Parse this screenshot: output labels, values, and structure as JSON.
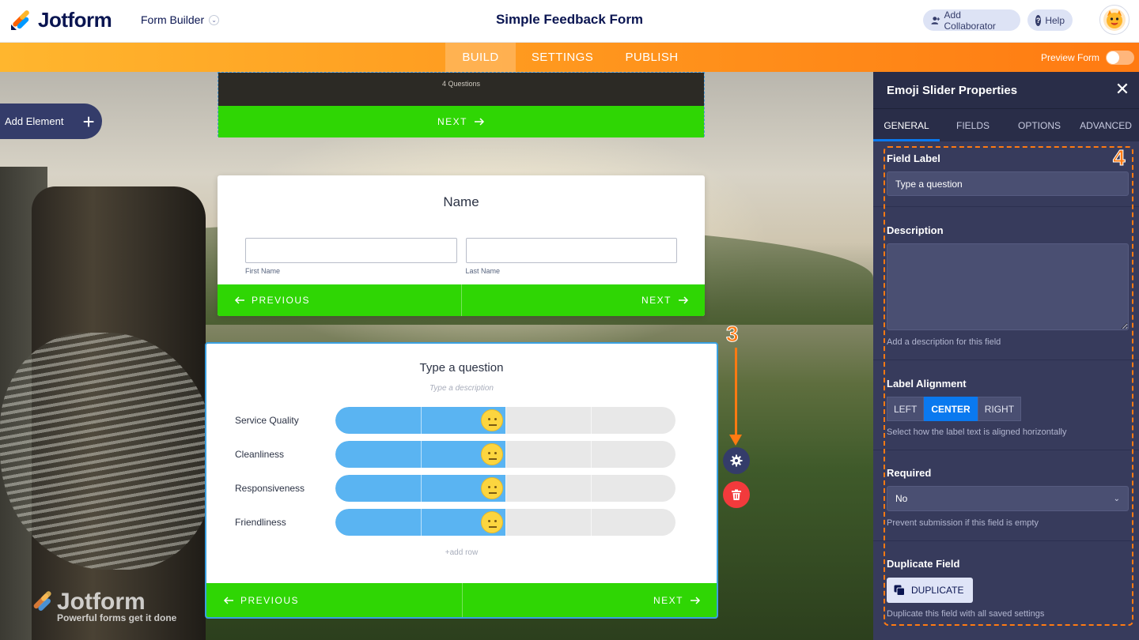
{
  "topbar": {
    "logo_text": "Jotform",
    "builder_label": "Form Builder",
    "form_title": "Simple Feedback Form",
    "add_collaborator": "Add Collaborator",
    "help": "Help"
  },
  "nav": {
    "tabs": [
      "BUILD",
      "SETTINGS",
      "PUBLISH"
    ],
    "active_tab": "BUILD",
    "preview_label": "Preview Form",
    "preview_on": false
  },
  "canvas": {
    "add_element": "Add Element",
    "watermark_title": "Jotform",
    "watermark_sub": "Powerful forms get it done"
  },
  "cards": {
    "top": {
      "subtitle": "4 Questions",
      "next": "NEXT"
    },
    "name": {
      "title": "Name",
      "first_label": "First Name",
      "last_label": "Last Name",
      "previous": "PREVIOUS",
      "next": "NEXT"
    },
    "emoji": {
      "title": "Type a question",
      "description": "Type a description",
      "rows": [
        {
          "label": "Service Quality",
          "level": 0.5
        },
        {
          "label": "Cleanliness",
          "level": 0.5
        },
        {
          "label": "Responsiveness",
          "level": 0.5
        },
        {
          "label": "Friendliness",
          "level": 0.5
        }
      ],
      "add_row": "+add row",
      "previous": "PREVIOUS",
      "next": "NEXT"
    }
  },
  "callouts": {
    "three": "3",
    "four": "4"
  },
  "panel": {
    "title": "Emoji Slider Properties",
    "tabs": [
      "GENERAL",
      "FIELDS",
      "OPTIONS",
      "ADVANCED"
    ],
    "active_tab": "GENERAL",
    "field_label": {
      "title": "Field Label",
      "value": "Type a question"
    },
    "description": {
      "title": "Description",
      "value": "",
      "hint": "Add a description for this field"
    },
    "label_alignment": {
      "title": "Label Alignment",
      "options": [
        "LEFT",
        "CENTER",
        "RIGHT"
      ],
      "selected": "CENTER",
      "hint": "Select how the label text is aligned horizontally"
    },
    "required": {
      "title": "Required",
      "value": "No",
      "hint": "Prevent submission if this field is empty"
    },
    "duplicate": {
      "title": "Duplicate Field",
      "button": "DUPLICATE",
      "hint": "Duplicate this field with all saved settings"
    }
  },
  "colors": {
    "brand_navy": "#0a1551",
    "orange": "#ff7a12",
    "green": "#2fd604",
    "slider_blue": "#5ab4f2",
    "panel_bg": "#373b5c",
    "accent_blue": "#0a79ef"
  },
  "icons": [
    "jotform-logo",
    "chevron-down-icon",
    "user-plus-icon",
    "help-icon",
    "avatar",
    "plus-icon",
    "arrow-right-icon",
    "arrow-left-icon",
    "gear-icon",
    "trash-icon",
    "close-icon",
    "copy-icon",
    "emoji-neutral-icon"
  ]
}
